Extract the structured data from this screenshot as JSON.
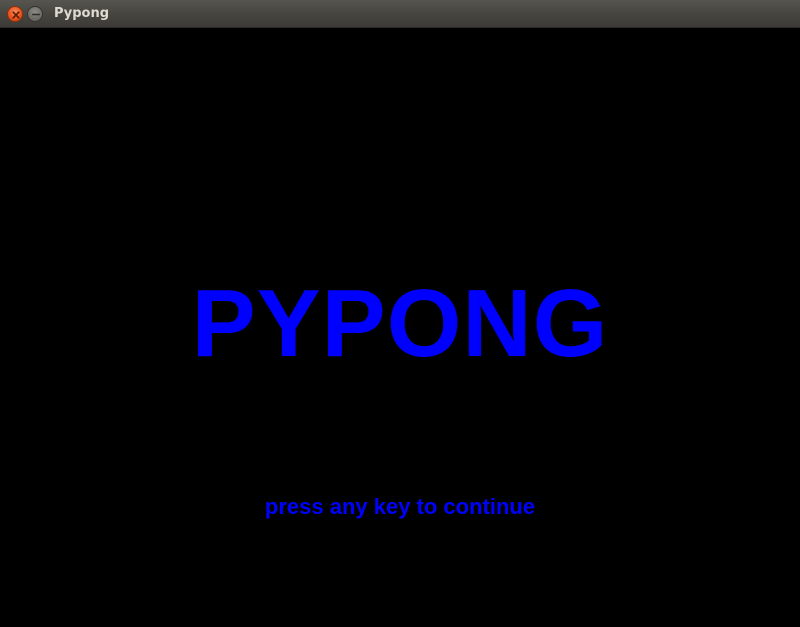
{
  "window": {
    "title": "Pypong"
  },
  "game": {
    "title": "PYPONG",
    "prompt": "press any key to continue"
  },
  "icons": {
    "close": "close-icon",
    "minimize": "minimize-icon"
  },
  "colors": {
    "background": "#000000",
    "text": "#0000ff",
    "titlebar": "#46443f",
    "close_button": "#e9541f",
    "minimize_button": "#6e6c67",
    "title_text": "#dfdbd2"
  }
}
